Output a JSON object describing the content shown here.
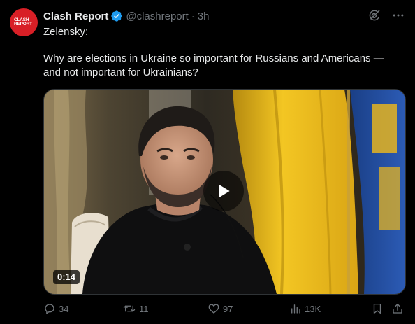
{
  "author": {
    "display_name": "Clash Report",
    "handle": "@clashreport",
    "separator": "·",
    "time": "3h",
    "avatar_text": "CLASH\nREPORT",
    "avatar_color": "#d81f26",
    "verified_color": "#1d9bf0"
  },
  "header_icons": [
    "grok-icon",
    "more-icon"
  ],
  "tweet": {
    "line1": "Zelensky:",
    "line2": "Why are elections in Ukraine so important for Russians and Americans — and not important for Ukrainians?"
  },
  "media": {
    "type": "video",
    "duration": "0:14",
    "icon": "play-icon"
  },
  "actions": {
    "replies": "34",
    "reposts": "11",
    "likes": "97",
    "views": "13K"
  },
  "colors": {
    "background": "#000000",
    "text": "#e7e9ea",
    "muted": "#71767b",
    "border": "#2f3336",
    "flag_yellow": "#f3c623",
    "flag_blue": "#1f4fa3"
  }
}
